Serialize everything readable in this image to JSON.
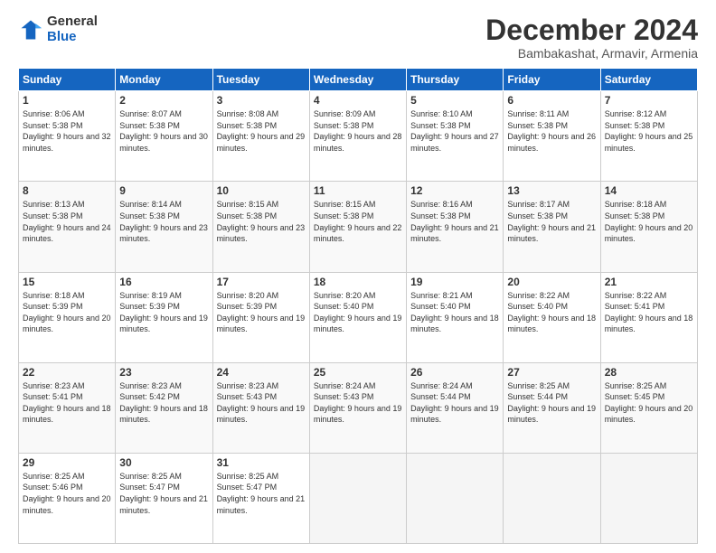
{
  "logo": {
    "general": "General",
    "blue": "Blue"
  },
  "header": {
    "title": "December 2024",
    "subtitle": "Bambakashat, Armavir, Armenia"
  },
  "days_of_week": [
    "Sunday",
    "Monday",
    "Tuesday",
    "Wednesday",
    "Thursday",
    "Friday",
    "Saturday"
  ],
  "weeks": [
    [
      {
        "day": "1",
        "sunrise": "Sunrise: 8:06 AM",
        "sunset": "Sunset: 5:38 PM",
        "daylight": "Daylight: 9 hours and 32 minutes."
      },
      {
        "day": "2",
        "sunrise": "Sunrise: 8:07 AM",
        "sunset": "Sunset: 5:38 PM",
        "daylight": "Daylight: 9 hours and 30 minutes."
      },
      {
        "day": "3",
        "sunrise": "Sunrise: 8:08 AM",
        "sunset": "Sunset: 5:38 PM",
        "daylight": "Daylight: 9 hours and 29 minutes."
      },
      {
        "day": "4",
        "sunrise": "Sunrise: 8:09 AM",
        "sunset": "Sunset: 5:38 PM",
        "daylight": "Daylight: 9 hours and 28 minutes."
      },
      {
        "day": "5",
        "sunrise": "Sunrise: 8:10 AM",
        "sunset": "Sunset: 5:38 PM",
        "daylight": "Daylight: 9 hours and 27 minutes."
      },
      {
        "day": "6",
        "sunrise": "Sunrise: 8:11 AM",
        "sunset": "Sunset: 5:38 PM",
        "daylight": "Daylight: 9 hours and 26 minutes."
      },
      {
        "day": "7",
        "sunrise": "Sunrise: 8:12 AM",
        "sunset": "Sunset: 5:38 PM",
        "daylight": "Daylight: 9 hours and 25 minutes."
      }
    ],
    [
      {
        "day": "8",
        "sunrise": "Sunrise: 8:13 AM",
        "sunset": "Sunset: 5:38 PM",
        "daylight": "Daylight: 9 hours and 24 minutes."
      },
      {
        "day": "9",
        "sunrise": "Sunrise: 8:14 AM",
        "sunset": "Sunset: 5:38 PM",
        "daylight": "Daylight: 9 hours and 23 minutes."
      },
      {
        "day": "10",
        "sunrise": "Sunrise: 8:15 AM",
        "sunset": "Sunset: 5:38 PM",
        "daylight": "Daylight: 9 hours and 23 minutes."
      },
      {
        "day": "11",
        "sunrise": "Sunrise: 8:15 AM",
        "sunset": "Sunset: 5:38 PM",
        "daylight": "Daylight: 9 hours and 22 minutes."
      },
      {
        "day": "12",
        "sunrise": "Sunrise: 8:16 AM",
        "sunset": "Sunset: 5:38 PM",
        "daylight": "Daylight: 9 hours and 21 minutes."
      },
      {
        "day": "13",
        "sunrise": "Sunrise: 8:17 AM",
        "sunset": "Sunset: 5:38 PM",
        "daylight": "Daylight: 9 hours and 21 minutes."
      },
      {
        "day": "14",
        "sunrise": "Sunrise: 8:18 AM",
        "sunset": "Sunset: 5:38 PM",
        "daylight": "Daylight: 9 hours and 20 minutes."
      }
    ],
    [
      {
        "day": "15",
        "sunrise": "Sunrise: 8:18 AM",
        "sunset": "Sunset: 5:39 PM",
        "daylight": "Daylight: 9 hours and 20 minutes."
      },
      {
        "day": "16",
        "sunrise": "Sunrise: 8:19 AM",
        "sunset": "Sunset: 5:39 PM",
        "daylight": "Daylight: 9 hours and 19 minutes."
      },
      {
        "day": "17",
        "sunrise": "Sunrise: 8:20 AM",
        "sunset": "Sunset: 5:39 PM",
        "daylight": "Daylight: 9 hours and 19 minutes."
      },
      {
        "day": "18",
        "sunrise": "Sunrise: 8:20 AM",
        "sunset": "Sunset: 5:40 PM",
        "daylight": "Daylight: 9 hours and 19 minutes."
      },
      {
        "day": "19",
        "sunrise": "Sunrise: 8:21 AM",
        "sunset": "Sunset: 5:40 PM",
        "daylight": "Daylight: 9 hours and 18 minutes."
      },
      {
        "day": "20",
        "sunrise": "Sunrise: 8:22 AM",
        "sunset": "Sunset: 5:40 PM",
        "daylight": "Daylight: 9 hours and 18 minutes."
      },
      {
        "day": "21",
        "sunrise": "Sunrise: 8:22 AM",
        "sunset": "Sunset: 5:41 PM",
        "daylight": "Daylight: 9 hours and 18 minutes."
      }
    ],
    [
      {
        "day": "22",
        "sunrise": "Sunrise: 8:23 AM",
        "sunset": "Sunset: 5:41 PM",
        "daylight": "Daylight: 9 hours and 18 minutes."
      },
      {
        "day": "23",
        "sunrise": "Sunrise: 8:23 AM",
        "sunset": "Sunset: 5:42 PM",
        "daylight": "Daylight: 9 hours and 18 minutes."
      },
      {
        "day": "24",
        "sunrise": "Sunrise: 8:23 AM",
        "sunset": "Sunset: 5:43 PM",
        "daylight": "Daylight: 9 hours and 19 minutes."
      },
      {
        "day": "25",
        "sunrise": "Sunrise: 8:24 AM",
        "sunset": "Sunset: 5:43 PM",
        "daylight": "Daylight: 9 hours and 19 minutes."
      },
      {
        "day": "26",
        "sunrise": "Sunrise: 8:24 AM",
        "sunset": "Sunset: 5:44 PM",
        "daylight": "Daylight: 9 hours and 19 minutes."
      },
      {
        "day": "27",
        "sunrise": "Sunrise: 8:25 AM",
        "sunset": "Sunset: 5:44 PM",
        "daylight": "Daylight: 9 hours and 19 minutes."
      },
      {
        "day": "28",
        "sunrise": "Sunrise: 8:25 AM",
        "sunset": "Sunset: 5:45 PM",
        "daylight": "Daylight: 9 hours and 20 minutes."
      }
    ],
    [
      {
        "day": "29",
        "sunrise": "Sunrise: 8:25 AM",
        "sunset": "Sunset: 5:46 PM",
        "daylight": "Daylight: 9 hours and 20 minutes."
      },
      {
        "day": "30",
        "sunrise": "Sunrise: 8:25 AM",
        "sunset": "Sunset: 5:47 PM",
        "daylight": "Daylight: 9 hours and 21 minutes."
      },
      {
        "day": "31",
        "sunrise": "Sunrise: 8:25 AM",
        "sunset": "Sunset: 5:47 PM",
        "daylight": "Daylight: 9 hours and 21 minutes."
      },
      null,
      null,
      null,
      null
    ]
  ]
}
